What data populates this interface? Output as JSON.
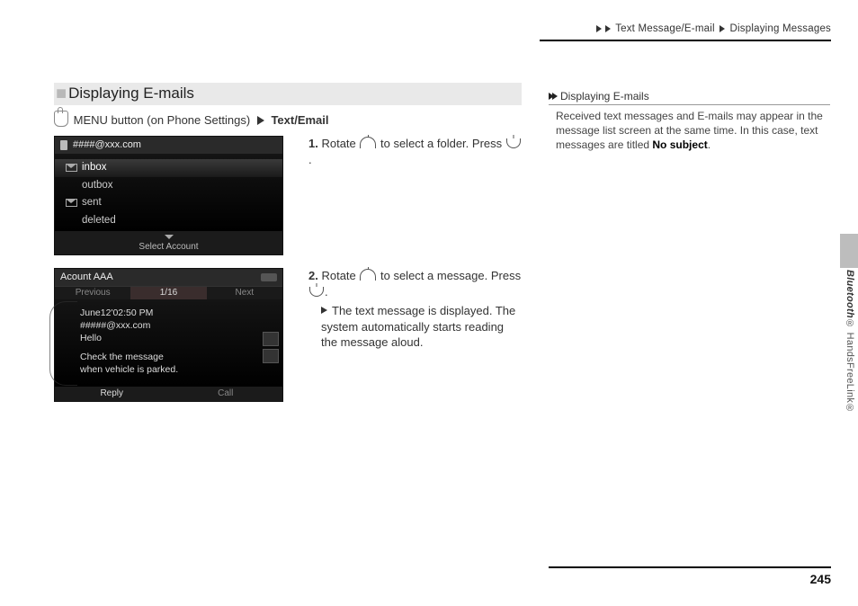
{
  "breadcrumb": {
    "a": "Text Message/E-mail",
    "b": "Displaying Messages"
  },
  "section": {
    "title": "Displaying E-mails",
    "nav_a": "MENU button (on Phone Settings)",
    "nav_b": "Text/Email"
  },
  "shot1": {
    "header": "####@xxx.com",
    "items": [
      "inbox",
      "outbox",
      "sent",
      "deleted"
    ],
    "footer": "Select Account"
  },
  "shot2": {
    "header": "Acount AAA",
    "pager": {
      "prev": "Previous",
      "pos": "1/16",
      "next": "Next"
    },
    "msg": {
      "line1": "June12'02:50 PM",
      "line2": "#####@xxx.com",
      "line3": "Hello",
      "line4": "Check the message",
      "line5": "when vehicle is parked."
    },
    "footer": {
      "reply": "Reply",
      "call": "Call"
    }
  },
  "steps": {
    "s1a": "1.",
    "s1b": "Rotate ",
    "s1c": " to select a folder. Press ",
    "s1d": ".",
    "s2a": "2.",
    "s2b": "Rotate ",
    "s2c": " to select a message. Press ",
    "s2d": ".",
    "s2e": "The text message is displayed. The system automatically starts reading the message aloud."
  },
  "aside": {
    "title": "Displaying E-mails",
    "body_a": "Received text messages and E-mails may appear in the message list screen at the same time. In this case, text messages are titled ",
    "body_b": "No subject",
    "body_c": "."
  },
  "side": {
    "a": "Bluetooth",
    "b": "® HandsFreeLink®"
  },
  "page": "245"
}
